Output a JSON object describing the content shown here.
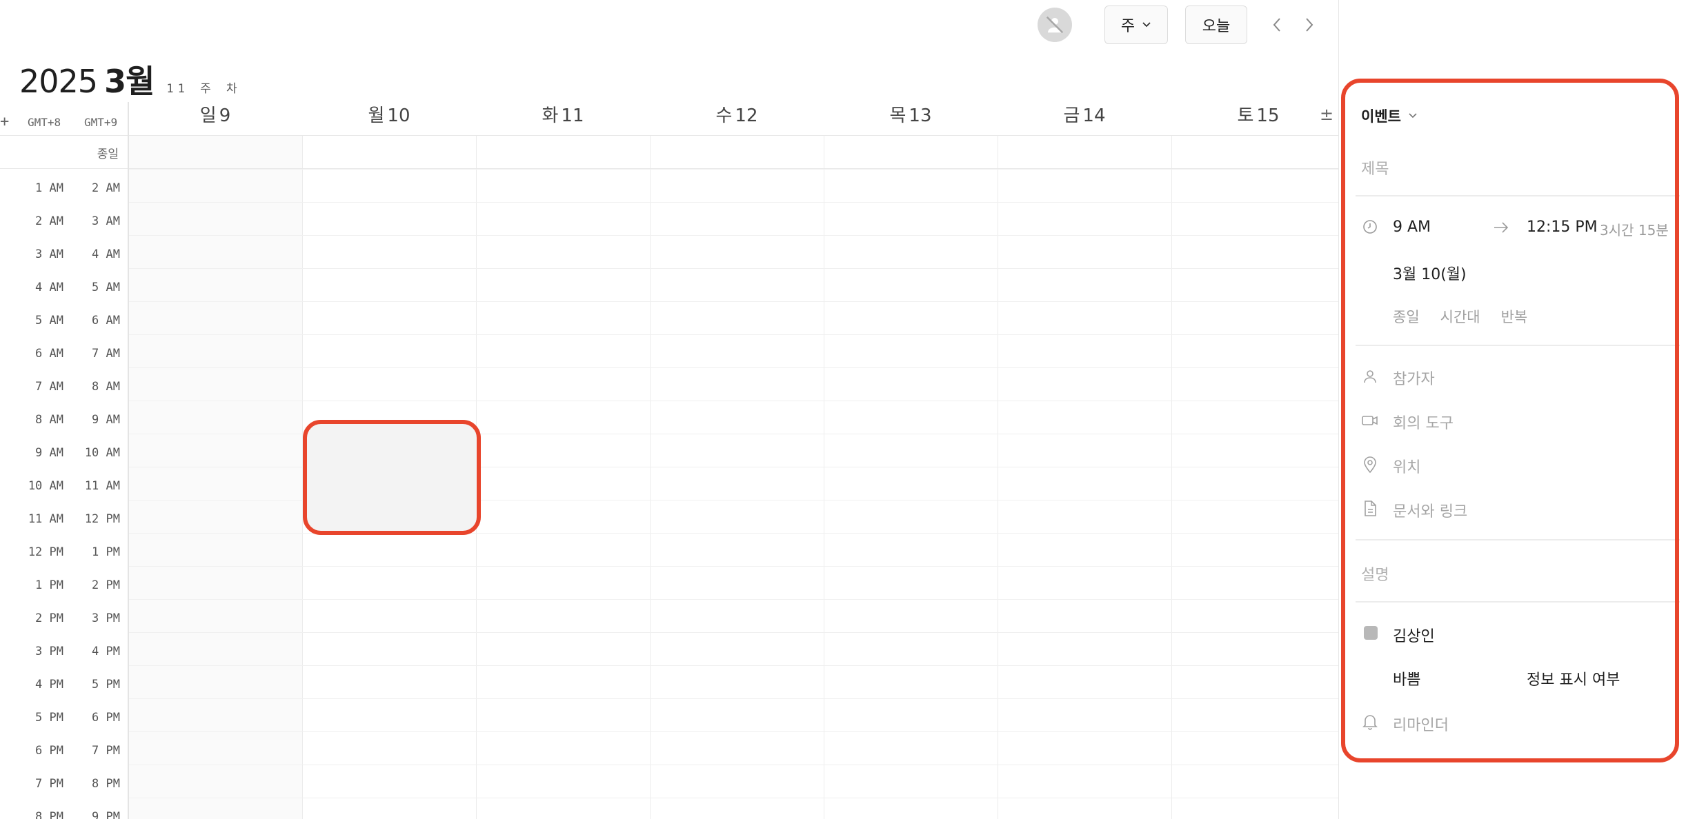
{
  "toolbar": {
    "avatar_icon": "user-off-icon",
    "view_label": "주",
    "today_label": "오늘"
  },
  "header": {
    "year": "2025",
    "month": "3월",
    "week_label": "11 주 차"
  },
  "timezones": {
    "add_label": "+",
    "primary": "GMT+8",
    "secondary": "GMT+9"
  },
  "days": [
    {
      "weekday": "일",
      "date": "9"
    },
    {
      "weekday": "월",
      "date": "10"
    },
    {
      "weekday": "화",
      "date": "11"
    },
    {
      "weekday": "수",
      "date": "12"
    },
    {
      "weekday": "목",
      "date": "13"
    },
    {
      "weekday": "금",
      "date": "14"
    },
    {
      "weekday": "토",
      "date": "15"
    }
  ],
  "expand_label": "±",
  "allday_label": "종일",
  "hours": [
    {
      "tz1": "1 AM",
      "tz2": "2 AM"
    },
    {
      "tz1": "2 AM",
      "tz2": "3 AM"
    },
    {
      "tz1": "3 AM",
      "tz2": "4 AM"
    },
    {
      "tz1": "4 AM",
      "tz2": "5 AM"
    },
    {
      "tz1": "5 AM",
      "tz2": "6 AM"
    },
    {
      "tz1": "6 AM",
      "tz2": "7 AM"
    },
    {
      "tz1": "7 AM",
      "tz2": "8 AM"
    },
    {
      "tz1": "8 AM",
      "tz2": "9 AM"
    },
    {
      "tz1": "9 AM",
      "tz2": "10 AM"
    },
    {
      "tz1": "10 AM",
      "tz2": "11 AM"
    },
    {
      "tz1": "11 AM",
      "tz2": "12 PM"
    },
    {
      "tz1": "12 PM",
      "tz2": "1 PM"
    },
    {
      "tz1": "1 PM",
      "tz2": "2 PM"
    },
    {
      "tz1": "2 PM",
      "tz2": "3 PM"
    },
    {
      "tz1": "3 PM",
      "tz2": "4 PM"
    },
    {
      "tz1": "4 PM",
      "tz2": "5 PM"
    },
    {
      "tz1": "5 PM",
      "tz2": "6 PM"
    },
    {
      "tz1": "6 PM",
      "tz2": "7 PM"
    },
    {
      "tz1": "7 PM",
      "tz2": "8 PM"
    },
    {
      "tz1": "8 PM",
      "tz2": "9 PM"
    }
  ],
  "panel": {
    "event_type": "이벤트",
    "title_placeholder": "제목",
    "start_time": "9 AM",
    "end_time": "12:15 PM",
    "duration": "3시간 15분",
    "date": "3월 10(월)",
    "options": [
      "종일",
      "시간대",
      "반복"
    ],
    "participants": "참가자",
    "meeting_tool": "회의 도구",
    "location": "위치",
    "docs_links": "문서와 링크",
    "description": "설명",
    "owner": "김상인",
    "busy": "바쁨",
    "visibility": "정보 표시 여부",
    "reminder": "리마인더"
  },
  "colors": {
    "highlight": "#e8452c",
    "owner_calendar": "#b8b8b8"
  }
}
